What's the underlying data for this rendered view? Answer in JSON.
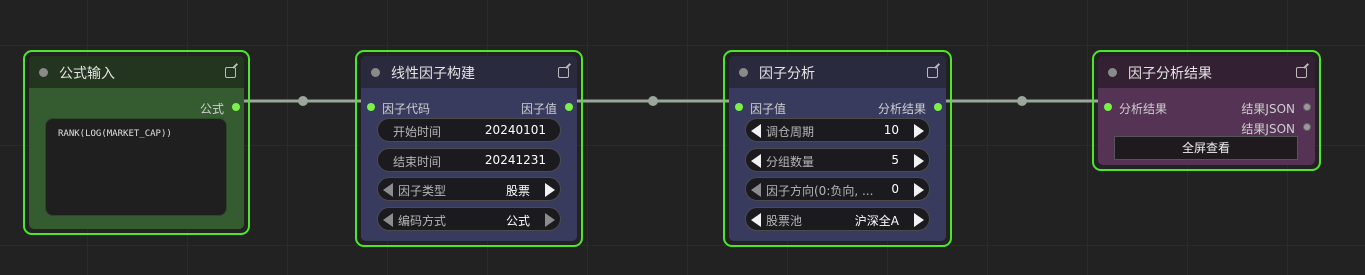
{
  "nodes": {
    "formula_input": {
      "title": "公式输入",
      "output_label": "公式",
      "formula": "RANK(LOG(MARKET_CAP))",
      "colors": {
        "header": "#23341f",
        "body": "#355c30"
      }
    },
    "linear_factor": {
      "title": "线性因子构建",
      "input_label": "因子代码",
      "output_label": "因子值",
      "widgets": [
        {
          "label": "开始时间",
          "value": "20240101"
        },
        {
          "label": "结束时间",
          "value": "20241231"
        },
        {
          "label": "因子类型",
          "value": "股票"
        },
        {
          "label": "编码方式",
          "value": "公式"
        }
      ],
      "colors": {
        "header": "#2a2a3f",
        "body": "#383b5e"
      }
    },
    "factor_analysis": {
      "title": "因子分析",
      "input_label": "因子值",
      "output_label": "分析结果",
      "widgets": [
        {
          "label": "调仓周期",
          "value": "10"
        },
        {
          "label": "分组数量",
          "value": "5"
        },
        {
          "label": "因子方向(0:负向,  ...",
          "value": "0"
        },
        {
          "label": "股票池",
          "value": "沪深全A"
        }
      ],
      "colors": {
        "header": "#2a2a3f",
        "body": "#383b5e"
      }
    },
    "analysis_result": {
      "title": "因子分析结果",
      "input_label": "分析结果",
      "outputs": [
        "结果JSON",
        "结果JSON"
      ],
      "button_label": "全屏查看",
      "colors": {
        "header": "#332133",
        "body": "#553355"
      }
    }
  },
  "colors": {
    "selection": "#4fe52c",
    "link": "#9aa79a",
    "pin_active": "#7cf04a",
    "canvas": "#222222"
  }
}
